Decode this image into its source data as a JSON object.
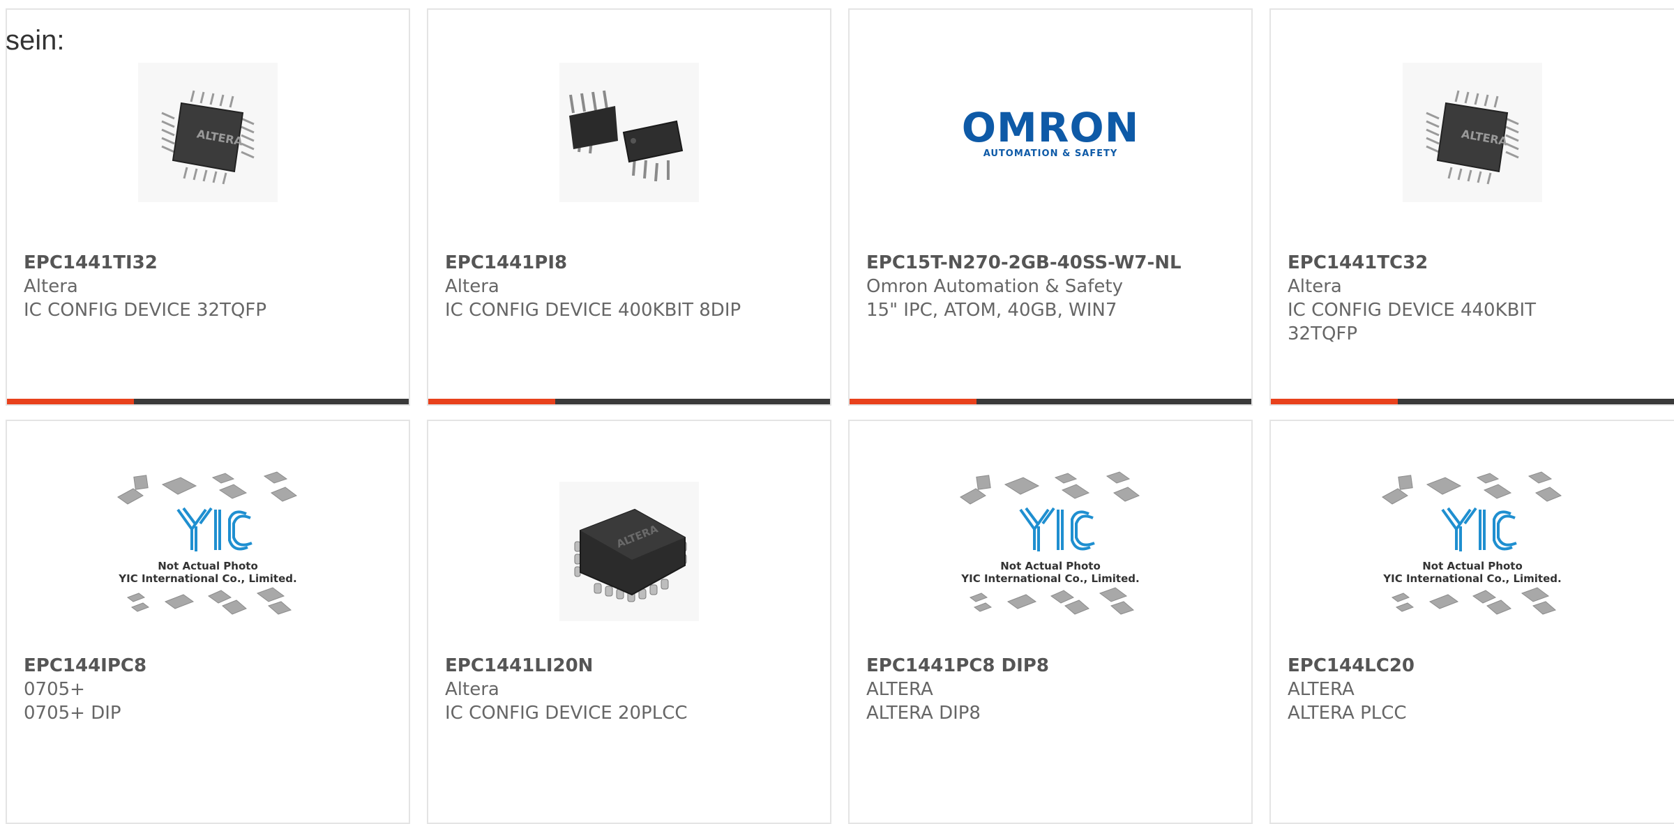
{
  "intro_text": "sein:",
  "colors": {
    "accent": "#e8411c",
    "bar": "#3a3a3a",
    "border": "#e4e4e4",
    "omron_blue": "#0e5aa7",
    "yic_blue": "#1f8fd0"
  },
  "products": [
    {
      "part": "EPC1441TI32",
      "manufacturer": "Altera",
      "description": "IC CONFIG DEVICE 32TQFP",
      "image": "tqfp-chip-image"
    },
    {
      "part": "EPC1441PI8",
      "manufacturer": "Altera",
      "description": "IC CONFIG DEVICE 400KBIT 8DIP",
      "image": "dip8-chip-image"
    },
    {
      "part": "EPC15T-N270-2GB-40SS-W7-NL",
      "manufacturer": "Omron Automation & Safety",
      "description": "15\" IPC, ATOM, 40GB, WIN7",
      "image": "omron-logo-image",
      "logo_text": "OMRON",
      "logo_tagline": "AUTOMATION & SAFETY"
    },
    {
      "part": "EPC1441TC32",
      "manufacturer": "Altera",
      "description": "IC CONFIG DEVICE 440KBIT 32TQFP",
      "image": "tqfp-chip-image"
    },
    {
      "part": "EPC144IPC8",
      "manufacturer": "0705+",
      "description": "0705+ DIP",
      "image": "yic-placeholder-image",
      "placeholder_line1": "Not Actual Photo",
      "placeholder_line2": "YIC International Co., Limited."
    },
    {
      "part": "EPC1441LI20N",
      "manufacturer": "Altera",
      "description": "IC CONFIG DEVICE 20PLCC",
      "image": "plcc-chip-image"
    },
    {
      "part": "EPC1441PC8 DIP8",
      "manufacturer": "ALTERA",
      "description": "ALTERA DIP8",
      "image": "yic-placeholder-image",
      "placeholder_line1": "Not Actual Photo",
      "placeholder_line2": "YIC International Co., Limited."
    },
    {
      "part": "EPC144LC20",
      "manufacturer": "ALTERA",
      "description": "ALTERA PLCC",
      "image": "yic-placeholder-image",
      "placeholder_line1": "Not Actual Photo",
      "placeholder_line2": "YIC International Co., Limited."
    }
  ]
}
